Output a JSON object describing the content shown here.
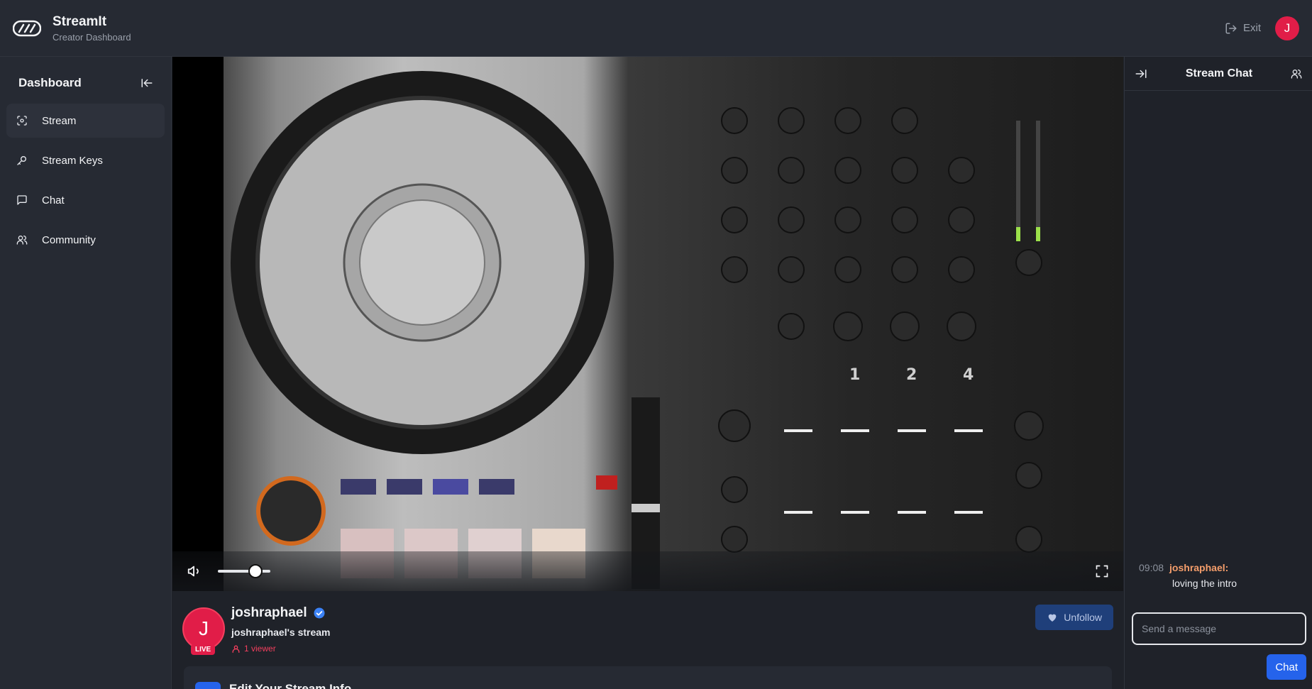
{
  "app": {
    "name": "StreamIt",
    "subtitle": "Creator Dashboard",
    "exit_label": "Exit",
    "user_initial": "J"
  },
  "sidebar": {
    "title": "Dashboard",
    "items": [
      {
        "label": "Stream",
        "icon": "scan-icon",
        "active": true
      },
      {
        "label": "Stream Keys",
        "icon": "key-icon",
        "active": false
      },
      {
        "label": "Chat",
        "icon": "message-square-icon",
        "active": false
      },
      {
        "label": "Community",
        "icon": "users-icon",
        "active": false
      }
    ]
  },
  "player": {
    "volume_level": 0.72,
    "volume_icon": "volume-icon",
    "fullscreen_icon": "fullscreen-icon"
  },
  "streamer": {
    "initial": "J",
    "live_label": "LIVE",
    "name": "joshraphael",
    "verified": true,
    "stream_title": "joshraphael's stream",
    "viewers": "1 viewer",
    "follow_button": "Unfollow"
  },
  "edit_card": {
    "title": "Edit Your Stream Info"
  },
  "chat": {
    "title": "Stream Chat",
    "messages": [
      {
        "time": "09:08",
        "user": "joshraphael:",
        "text": "loving the intro"
      }
    ],
    "input_placeholder": "Send a message",
    "send_label": "Chat"
  },
  "colors": {
    "accent": "#2563eb",
    "live": "#e11d48",
    "username": "#f59e6b"
  }
}
